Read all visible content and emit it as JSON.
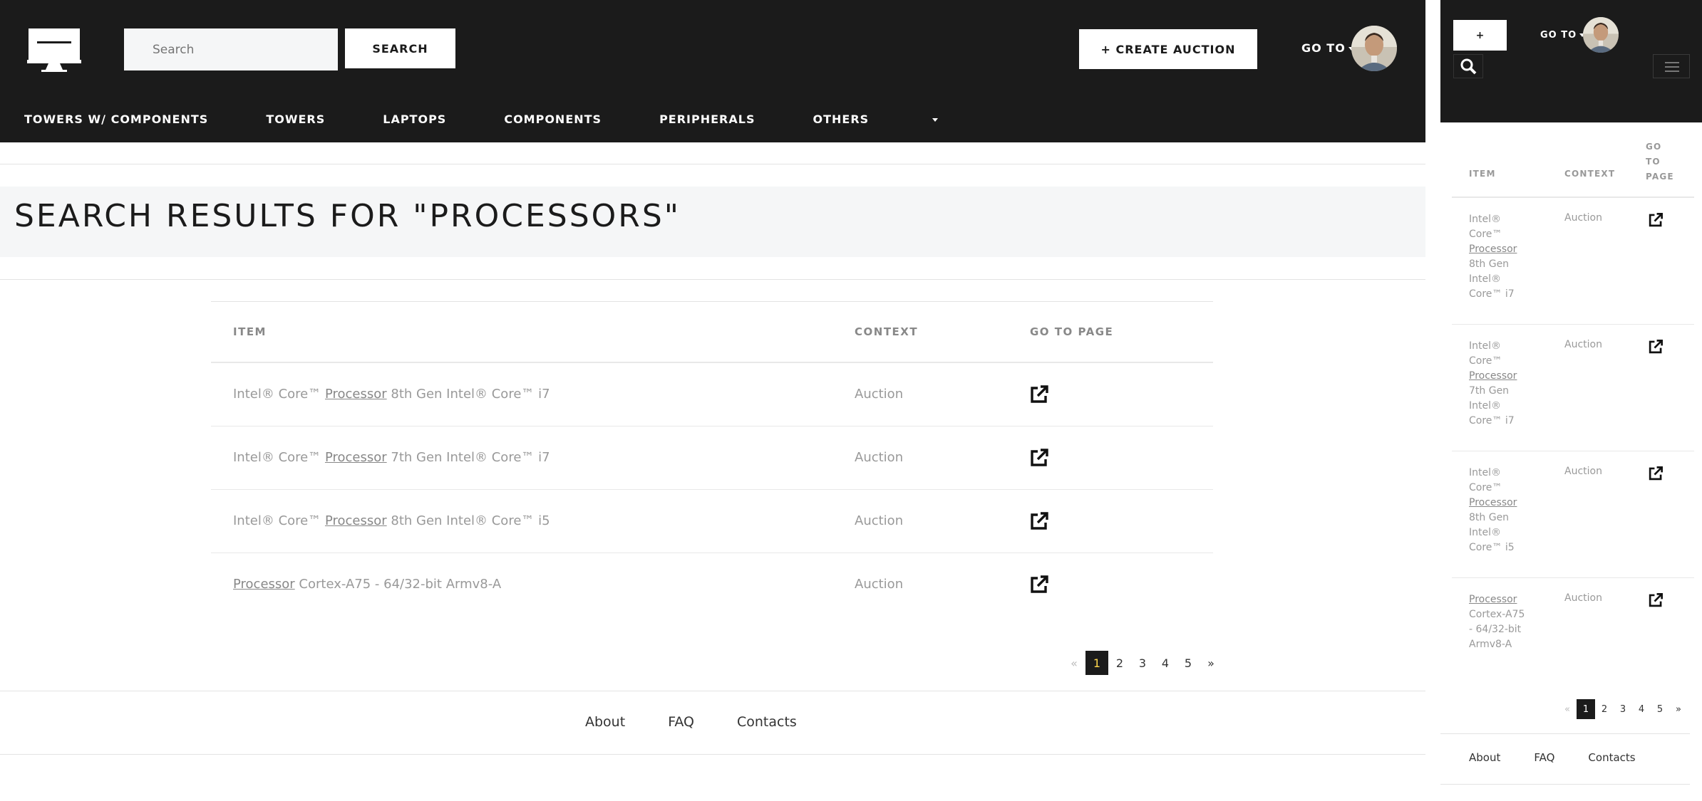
{
  "search": {
    "placeholder": "Search",
    "button_label": "SEARCH"
  },
  "header": {
    "create_label": "+ CREATE AUCTION",
    "goto_label": "GO TO"
  },
  "nav": {
    "items": [
      "TOWERS W/ COMPONENTS",
      "TOWERS",
      "LAPTOPS",
      "COMPONENTS",
      "PERIPHERALS",
      "OTHERS"
    ]
  },
  "page": {
    "title": "SEARCH RESULTS FOR \"PROCESSORS\""
  },
  "table": {
    "columns": {
      "item": "ITEM",
      "context": "CONTEXT",
      "goto": "GO TO PAGE"
    },
    "rows": [
      {
        "before": "Intel® Core™ ",
        "match": "Processor",
        "after": " 8th Gen Intel® Core™ i7",
        "context": "Auction"
      },
      {
        "before": "Intel® Core™ ",
        "match": "Processor",
        "after": " 7th Gen Intel® Core™ i7",
        "context": "Auction"
      },
      {
        "before": "Intel® Core™ ",
        "match": "Processor",
        "after": " 8th Gen Intel® Core™ i5",
        "context": "Auction"
      },
      {
        "before": "",
        "match": "Processor",
        "after": " Cortex-A75 - 64/32-bit Armv8-A",
        "context": "Auction"
      }
    ]
  },
  "pagination": {
    "prev": "«",
    "pages": [
      "1",
      "2",
      "3",
      "4",
      "5"
    ],
    "current": "1",
    "next": "»"
  },
  "footer": {
    "links": [
      "About",
      "FAQ",
      "Contacts"
    ]
  },
  "mobile": {
    "plus_label": "+",
    "goto_label": "GO TO",
    "columns": {
      "item": "ITEM",
      "context": "CONTEXT",
      "goto": [
        "GO",
        "TO",
        "PAGE"
      ]
    },
    "rows": [
      {
        "lines": [
          "Intel®",
          "Core™",
          "Processor",
          "8th Gen",
          "Intel®",
          "Core™ i7"
        ],
        "context": "Auction"
      },
      {
        "lines": [
          "Intel®",
          "Core™",
          "Processor",
          "7th Gen",
          "Intel®",
          "Core™ i7"
        ],
        "context": "Auction"
      },
      {
        "lines": [
          "Intel®",
          "Core™",
          "Processor",
          "8th Gen",
          "Intel®",
          "Core™ i5"
        ],
        "context": "Auction"
      },
      {
        "lines": [
          "Processor",
          "Cortex-A75",
          "- 64/32-bit",
          "Armv8-A"
        ],
        "context": "Auction"
      }
    ]
  },
  "icons": {
    "logo": "monitor-logo-icon",
    "external": "external-link-icon",
    "search": "magnifier-icon",
    "menu": "hamburger-icon"
  },
  "colors": {
    "header_bg": "#1b1b1b",
    "band_bg": "#f5f6f7",
    "active_page_text": "#ffd84d"
  }
}
